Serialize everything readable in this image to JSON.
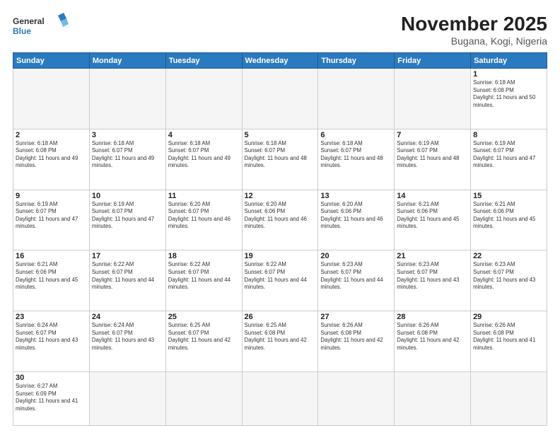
{
  "logo": {
    "general": "General",
    "blue": "Blue"
  },
  "header": {
    "title": "November 2025",
    "subtitle": "Bugana, Kogi, Nigeria"
  },
  "weekdays": [
    "Sunday",
    "Monday",
    "Tuesday",
    "Wednesday",
    "Thursday",
    "Friday",
    "Saturday"
  ],
  "days": {
    "d1": {
      "num": "1",
      "sunrise": "Sunrise: 6:18 AM",
      "sunset": "Sunset: 6:08 PM",
      "daylight": "Daylight: 11 hours and 50 minutes."
    },
    "d2": {
      "num": "2",
      "sunrise": "Sunrise: 6:18 AM",
      "sunset": "Sunset: 6:08 PM",
      "daylight": "Daylight: 11 hours and 49 minutes."
    },
    "d3": {
      "num": "3",
      "sunrise": "Sunrise: 6:18 AM",
      "sunset": "Sunset: 6:07 PM",
      "daylight": "Daylight: 11 hours and 49 minutes."
    },
    "d4": {
      "num": "4",
      "sunrise": "Sunrise: 6:18 AM",
      "sunset": "Sunset: 6:07 PM",
      "daylight": "Daylight: 11 hours and 49 minutes."
    },
    "d5": {
      "num": "5",
      "sunrise": "Sunrise: 6:18 AM",
      "sunset": "Sunset: 6:07 PM",
      "daylight": "Daylight: 11 hours and 48 minutes."
    },
    "d6": {
      "num": "6",
      "sunrise": "Sunrise: 6:18 AM",
      "sunset": "Sunset: 6:07 PM",
      "daylight": "Daylight: 11 hours and 48 minutes."
    },
    "d7": {
      "num": "7",
      "sunrise": "Sunrise: 6:19 AM",
      "sunset": "Sunset: 6:07 PM",
      "daylight": "Daylight: 11 hours and 48 minutes."
    },
    "d8": {
      "num": "8",
      "sunrise": "Sunrise: 6:19 AM",
      "sunset": "Sunset: 6:07 PM",
      "daylight": "Daylight: 11 hours and 47 minutes."
    },
    "d9": {
      "num": "9",
      "sunrise": "Sunrise: 6:19 AM",
      "sunset": "Sunset: 6:07 PM",
      "daylight": "Daylight: 11 hours and 47 minutes."
    },
    "d10": {
      "num": "10",
      "sunrise": "Sunrise: 6:19 AM",
      "sunset": "Sunset: 6:07 PM",
      "daylight": "Daylight: 11 hours and 47 minutes."
    },
    "d11": {
      "num": "11",
      "sunrise": "Sunrise: 6:20 AM",
      "sunset": "Sunset: 6:07 PM",
      "daylight": "Daylight: 11 hours and 46 minutes."
    },
    "d12": {
      "num": "12",
      "sunrise": "Sunrise: 6:20 AM",
      "sunset": "Sunset: 6:06 PM",
      "daylight": "Daylight: 11 hours and 46 minutes."
    },
    "d13": {
      "num": "13",
      "sunrise": "Sunrise: 6:20 AM",
      "sunset": "Sunset: 6:06 PM",
      "daylight": "Daylight: 11 hours and 46 minutes."
    },
    "d14": {
      "num": "14",
      "sunrise": "Sunrise: 6:21 AM",
      "sunset": "Sunset: 6:06 PM",
      "daylight": "Daylight: 11 hours and 45 minutes."
    },
    "d15": {
      "num": "15",
      "sunrise": "Sunrise: 6:21 AM",
      "sunset": "Sunset: 6:06 PM",
      "daylight": "Daylight: 11 hours and 45 minutes."
    },
    "d16": {
      "num": "16",
      "sunrise": "Sunrise: 6:21 AM",
      "sunset": "Sunset: 6:06 PM",
      "daylight": "Daylight: 11 hours and 45 minutes."
    },
    "d17": {
      "num": "17",
      "sunrise": "Sunrise: 6:22 AM",
      "sunset": "Sunset: 6:07 PM",
      "daylight": "Daylight: 11 hours and 44 minutes."
    },
    "d18": {
      "num": "18",
      "sunrise": "Sunrise: 6:22 AM",
      "sunset": "Sunset: 6:07 PM",
      "daylight": "Daylight: 11 hours and 44 minutes."
    },
    "d19": {
      "num": "19",
      "sunrise": "Sunrise: 6:22 AM",
      "sunset": "Sunset: 6:07 PM",
      "daylight": "Daylight: 11 hours and 44 minutes."
    },
    "d20": {
      "num": "20",
      "sunrise": "Sunrise: 6:23 AM",
      "sunset": "Sunset: 6:07 PM",
      "daylight": "Daylight: 11 hours and 44 minutes."
    },
    "d21": {
      "num": "21",
      "sunrise": "Sunrise: 6:23 AM",
      "sunset": "Sunset: 6:07 PM",
      "daylight": "Daylight: 11 hours and 43 minutes."
    },
    "d22": {
      "num": "22",
      "sunrise": "Sunrise: 6:23 AM",
      "sunset": "Sunset: 6:07 PM",
      "daylight": "Daylight: 11 hours and 43 minutes."
    },
    "d23": {
      "num": "23",
      "sunrise": "Sunrise: 6:24 AM",
      "sunset": "Sunset: 6:07 PM",
      "daylight": "Daylight: 11 hours and 43 minutes."
    },
    "d24": {
      "num": "24",
      "sunrise": "Sunrise: 6:24 AM",
      "sunset": "Sunset: 6:07 PM",
      "daylight": "Daylight: 11 hours and 43 minutes."
    },
    "d25": {
      "num": "25",
      "sunrise": "Sunrise: 6:25 AM",
      "sunset": "Sunset: 6:07 PM",
      "daylight": "Daylight: 11 hours and 42 minutes."
    },
    "d26": {
      "num": "26",
      "sunrise": "Sunrise: 6:25 AM",
      "sunset": "Sunset: 6:08 PM",
      "daylight": "Daylight: 11 hours and 42 minutes."
    },
    "d27": {
      "num": "27",
      "sunrise": "Sunrise: 6:26 AM",
      "sunset": "Sunset: 6:08 PM",
      "daylight": "Daylight: 11 hours and 42 minutes."
    },
    "d28": {
      "num": "28",
      "sunrise": "Sunrise: 6:26 AM",
      "sunset": "Sunset: 6:08 PM",
      "daylight": "Daylight: 11 hours and 42 minutes."
    },
    "d29": {
      "num": "29",
      "sunrise": "Sunrise: 6:26 AM",
      "sunset": "Sunset: 6:08 PM",
      "daylight": "Daylight: 11 hours and 41 minutes."
    },
    "d30": {
      "num": "30",
      "sunrise": "Sunrise: 6:27 AM",
      "sunset": "Sunset: 6:09 PM",
      "daylight": "Daylight: 11 hours and 41 minutes."
    }
  }
}
